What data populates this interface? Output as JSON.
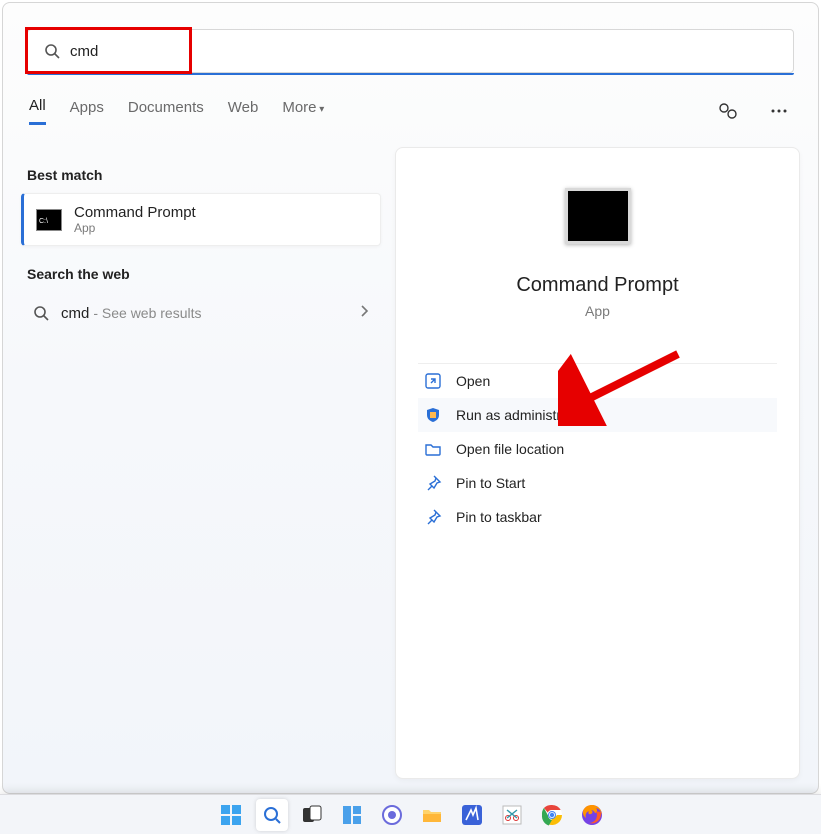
{
  "search": {
    "value": "cmd"
  },
  "tabs": {
    "all": "All",
    "apps": "Apps",
    "documents": "Documents",
    "web": "Web",
    "more": "More"
  },
  "sections": {
    "best_match": "Best match",
    "search_web": "Search the web"
  },
  "best_match": {
    "title": "Command Prompt",
    "subtitle": "App"
  },
  "web_result": {
    "query": "cmd",
    "hint": "- See web results"
  },
  "preview": {
    "title": "Command Prompt",
    "subtitle": "App"
  },
  "actions": {
    "open": "Open",
    "run_admin": "Run as administrator",
    "open_file_location": "Open file location",
    "pin_start": "Pin to Start",
    "pin_taskbar": "Pin to taskbar"
  },
  "colors": {
    "accent": "#2a6fd6",
    "highlight": "#e60000"
  }
}
